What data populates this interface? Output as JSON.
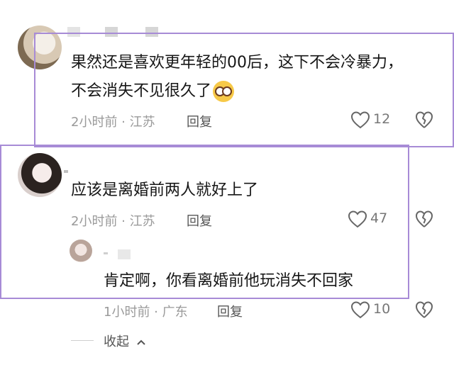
{
  "comments": [
    {
      "line1": "果然还是喜欢更年轻的00后，这下不会冷暴力，",
      "line2": "不会消失不见很久了",
      "emoji": "dizzy-face",
      "meta": "2小时前 · 江苏",
      "reply_label": "回复",
      "likes": "12"
    },
    {
      "line1": "应该是离婚前两人就好上了",
      "meta": "2小时前 · 江苏",
      "reply_label": "回复",
      "likes": "47",
      "replies": [
        {
          "text": "肯定啊，你看离婚前他玩消失不回家",
          "meta": "1小时前 · 广东",
          "reply_label": "回复",
          "likes": "10"
        }
      ]
    }
  ],
  "collapse_label": "收起",
  "colors": {
    "frame": "#a78bd6",
    "meta": "#9a9a9a",
    "text": "#161616"
  },
  "icons": [
    "heart-outline-icon",
    "broken-heart-icon",
    "chevron-up-icon"
  ]
}
